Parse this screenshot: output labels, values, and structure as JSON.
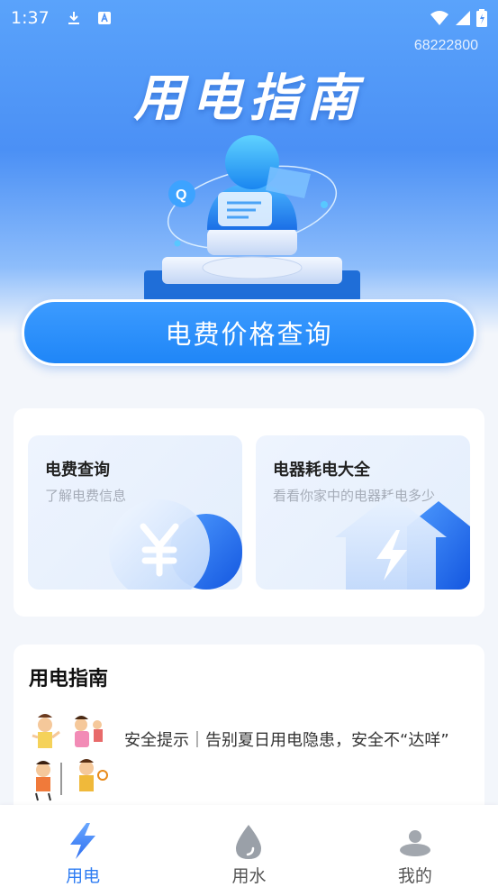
{
  "status_bar": {
    "time": "1:37"
  },
  "hotline": "68222800",
  "hero": {
    "title": "用电指南"
  },
  "query_button": "电费价格查询",
  "features": [
    {
      "title": "电费查询",
      "subtitle": "了解电费信息",
      "icon": "yuan-coin-icon"
    },
    {
      "title": "电器耗电大全",
      "subtitle": "看看你家中的电器耗电多少",
      "icon": "lightning-house-icon"
    }
  ],
  "guide": {
    "heading": "用电指南",
    "article": "安全提示｜告别夏日用电隐患，安全不“达咩”"
  },
  "tabs": [
    {
      "label": "用电",
      "icon": "lightning-icon",
      "active": true
    },
    {
      "label": "用水",
      "icon": "water-drop-icon",
      "active": false
    },
    {
      "label": "我的",
      "icon": "user-icon",
      "active": false
    }
  ],
  "colors": {
    "accent": "#2f7df3",
    "hero_blue": "#4b90f5"
  }
}
